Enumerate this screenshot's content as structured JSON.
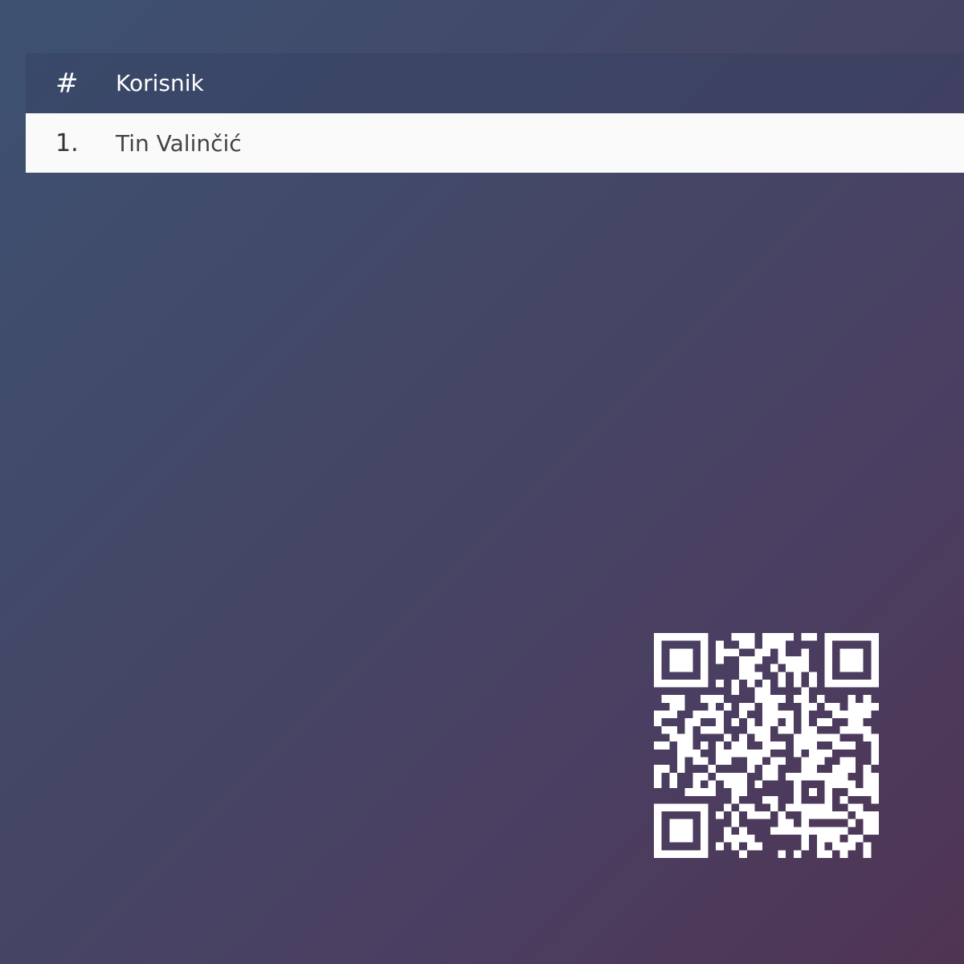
{
  "leaderboard": {
    "header": {
      "rank": "#",
      "user": "Korisnik"
    },
    "rows": [
      {
        "rank": "1.",
        "user": "Tin Valinčić"
      }
    ]
  },
  "qr_code": {
    "icon": "qr-code-icon",
    "color": "#ffffff"
  },
  "colors": {
    "background_start": "#3d5171",
    "background_end": "#503453",
    "row_background": "#fafafa",
    "header_text": "#ffffff"
  }
}
